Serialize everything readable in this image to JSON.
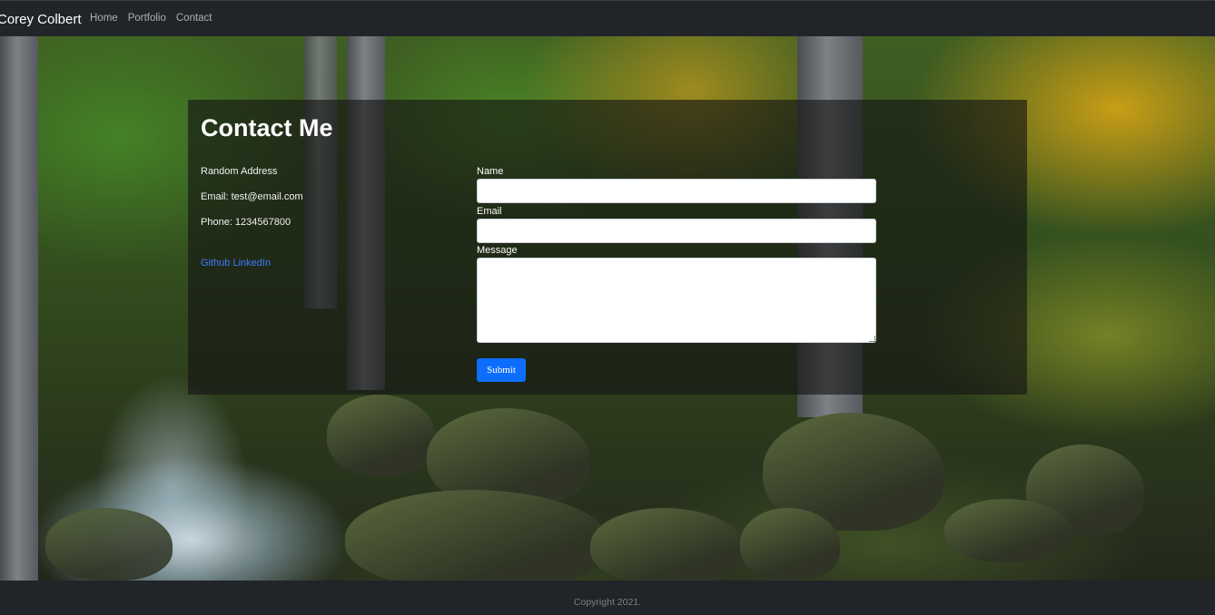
{
  "navbar": {
    "brand": "Corey Colbert",
    "links": [
      "Home",
      "Portfolio",
      "Contact"
    ]
  },
  "contact": {
    "title": "Contact Me",
    "address": "Random Address",
    "email": "Email: test@email.com",
    "phone": "Phone: 1234567800",
    "social": [
      "Github",
      "LinkedIn"
    ]
  },
  "form": {
    "name_label": "Name",
    "name_value": "",
    "email_label": "Email",
    "email_value": "",
    "message_label": "Message",
    "message_value": "",
    "submit_label": "Submit"
  },
  "footer": {
    "copyright": "Copyright 2021."
  },
  "colors": {
    "navbar_bg": "#212529",
    "primary_button": "#0d6efd",
    "link": "#3d7bff",
    "footer_text": "#7b8086"
  }
}
